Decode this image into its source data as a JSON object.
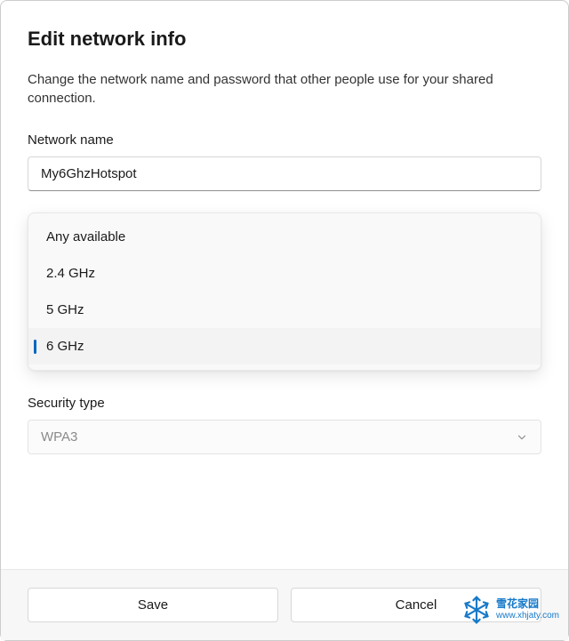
{
  "dialog": {
    "title": "Edit network info",
    "description": "Change the network name and password that other people use for your shared connection."
  },
  "network_name": {
    "label": "Network name",
    "value": "My6GhzHotspot"
  },
  "band": {
    "options": [
      "Any available",
      "2.4 GHz",
      "5 GHz",
      "6 GHz"
    ],
    "selected_index": 3
  },
  "security": {
    "label": "Security type",
    "value": "WPA3"
  },
  "footer": {
    "save_label": "Save",
    "cancel_label": "Cancel"
  },
  "watermark": {
    "brand": "雪花家园",
    "url": "www.xhjaty.com"
  }
}
